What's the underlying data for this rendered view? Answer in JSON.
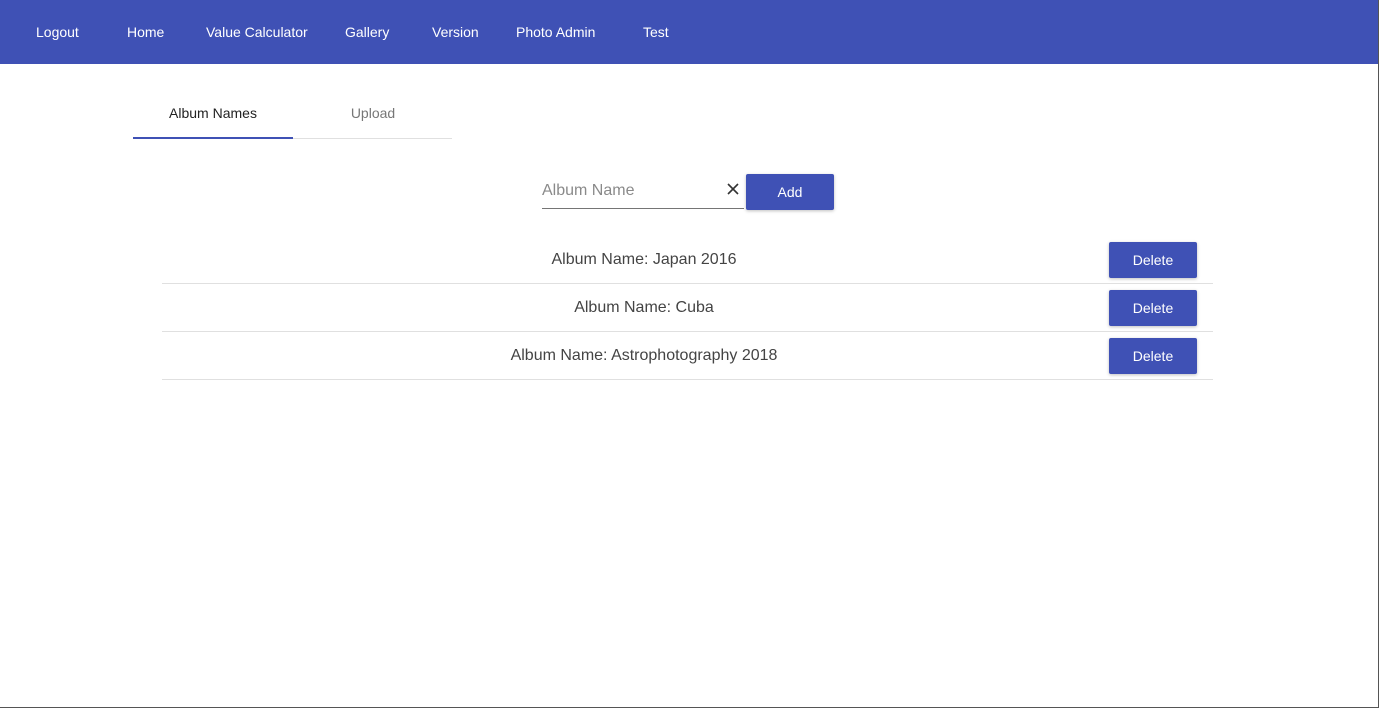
{
  "nav": {
    "logout": "Logout",
    "home": "Home",
    "value_calculator": "Value Calculator",
    "gallery": "Gallery",
    "version": "Version",
    "photo_admin": "Photo Admin",
    "test": "Test"
  },
  "tabs": {
    "album_names": "Album Names",
    "upload": "Upload",
    "active": "Album Names"
  },
  "form": {
    "placeholder": "Album Name",
    "value": "",
    "add_label": "Add"
  },
  "albums": [
    {
      "text": "Album Name: Japan 2016",
      "action": "Delete"
    },
    {
      "text": "Album Name: Cuba",
      "action": "Delete"
    },
    {
      "text": "Album Name: Astrophotography 2018",
      "action": "Delete"
    }
  ],
  "colors": {
    "primary": "#3f51b5",
    "navbar_text": "#ffffff",
    "divider": "#e0e0e0"
  },
  "icons": {
    "clear": "close-icon"
  }
}
